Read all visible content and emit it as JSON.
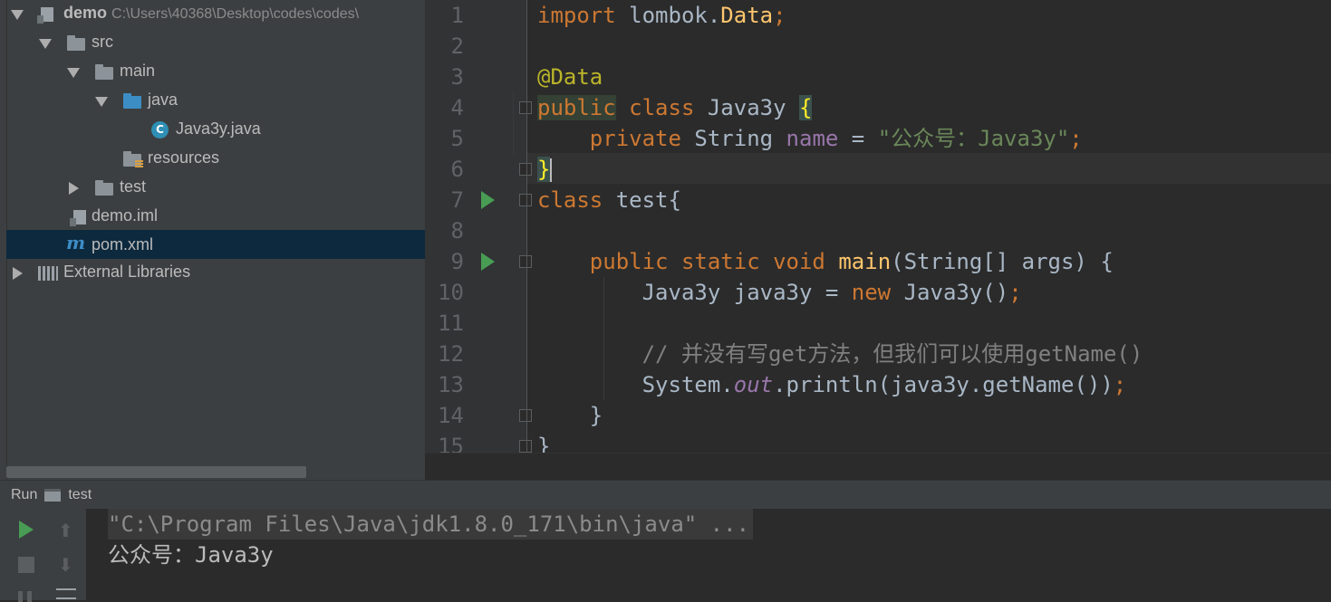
{
  "project": {
    "root_name": "demo",
    "root_path": "C:\\Users\\40368\\Desktop\\codes\\codes\\",
    "src": "src",
    "main": "main",
    "java": "java",
    "class_file": "Java3y.java",
    "class_letter": "C",
    "resources": "resources",
    "test": "test",
    "iml": "demo.iml",
    "pom_letter": "m",
    "pom": "pom.xml",
    "libraries": "External Libraries"
  },
  "editor": {
    "line_numbers": [
      "1",
      "2",
      "3",
      "4",
      "5",
      "6",
      "7",
      "8",
      "9",
      "10",
      "11",
      "12",
      "13",
      "14",
      "15"
    ],
    "l1_kw": "import",
    "l1_rest": " lombok.",
    "l1_cls": "Data",
    "l1_semi": ";",
    "l3_ann": "@Data",
    "l4_public": "public",
    "l4_class": " class",
    "l4_name": " Java3y ",
    "l4_brace": "{",
    "l5_private": "    private",
    "l5_type": " String ",
    "l5_field": "name",
    "l5_eq": " = ",
    "l5_str": "\"公众号：Java3y\"",
    "l5_semi": ";",
    "l6_brace": "}",
    "l7_class": "class",
    "l7_rest": " test{",
    "l9_mods": "    public static void",
    "l9_sp": " ",
    "l9_fn": "main",
    "l9_args": "(String[] args) {",
    "l10_left": "        Java3y java3y = ",
    "l10_new": "new",
    "l10_right": " Java3y()",
    "l10_semi": ";",
    "l12_comment": "        // 并没有写get方法，但我们可以使用getName()",
    "l13_sys": "        System.",
    "l13_out": "out",
    "l13_rest": ".println(java3y.getName())",
    "l13_semi": ";",
    "l14": "    }",
    "l15": "}"
  },
  "run": {
    "tab_label": "Run",
    "config_name": "test",
    "command": "\"C:\\Program Files\\Java\\jdk1.8.0_171\\bin\\java\" ...",
    "output": "公众号：Java3y"
  },
  "colors": {
    "keyword": "#cc7832",
    "annotation": "#bbb529",
    "string": "#6a8759",
    "field": "#9876aa",
    "function": "#ffc66d",
    "comment": "#808080"
  }
}
